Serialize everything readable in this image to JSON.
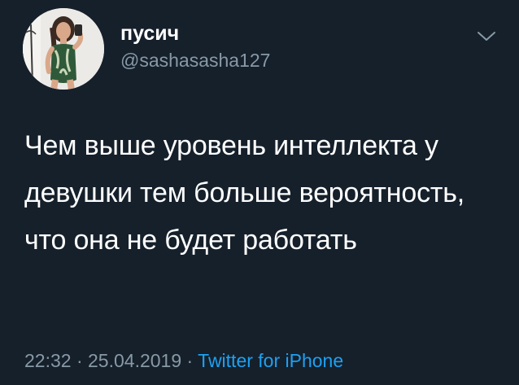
{
  "user": {
    "display_name": "пусич",
    "handle": "@sashasasha127",
    "avatar_icon": "profile-photo-avatar"
  },
  "tweet": {
    "text": "Чем выше уровень интеллекта у девушки тем больше вероятность, что она не будет работать"
  },
  "meta": {
    "time": "22:32",
    "separator": " · ",
    "date": "25.04.2019",
    "source": "Twitter for iPhone"
  },
  "icons": {
    "menu": "chevron-down-icon"
  },
  "colors": {
    "background": "#15202b",
    "text": "#ffffff",
    "secondary": "#8899a6",
    "link": "#1da1f2"
  }
}
